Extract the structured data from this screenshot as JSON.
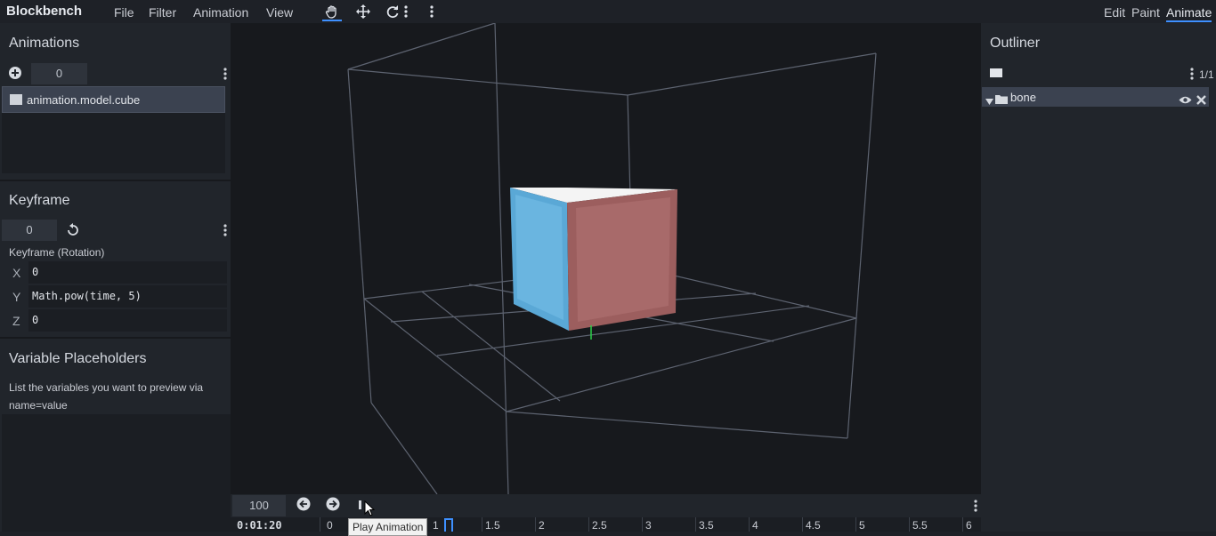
{
  "app": {
    "title": "Blockbench"
  },
  "menu": {
    "file": "File",
    "filter": "Filter",
    "animation": "Animation",
    "view": "View"
  },
  "modes": {
    "edit": "Edit",
    "paint": "Paint",
    "animate": "Animate"
  },
  "animations_panel": {
    "title": "Animations",
    "counter": "0",
    "items": [
      {
        "label": "animation.model.cube"
      }
    ]
  },
  "keyframe_panel": {
    "title": "Keyframe",
    "value": "0",
    "type_label": "Keyframe (Rotation)",
    "axes": [
      {
        "axis": "X",
        "value": "0"
      },
      {
        "axis": "Y",
        "value": "Math.pow(time, 5)"
      },
      {
        "axis": "Z",
        "value": "0"
      }
    ]
  },
  "variable_placeholders": {
    "title": "Variable Placeholders",
    "description": "List the variables you want to preview via name=value"
  },
  "outliner": {
    "title": "Outliner",
    "count": "1/1",
    "items": [
      {
        "label": "bone"
      }
    ]
  },
  "timeline": {
    "zoom": "100",
    "time": "0:01:20",
    "tooltip": "Play Animation",
    "ticks": [
      "0",
      "1",
      "1.5",
      "2",
      "2.5",
      "3",
      "3.5",
      "4",
      "4.5",
      "5",
      "5.5",
      "6"
    ]
  },
  "colors": {
    "accent": "#3e90ff",
    "cube_side": "#5fb0e0",
    "cube_front": "#a86a6a"
  }
}
